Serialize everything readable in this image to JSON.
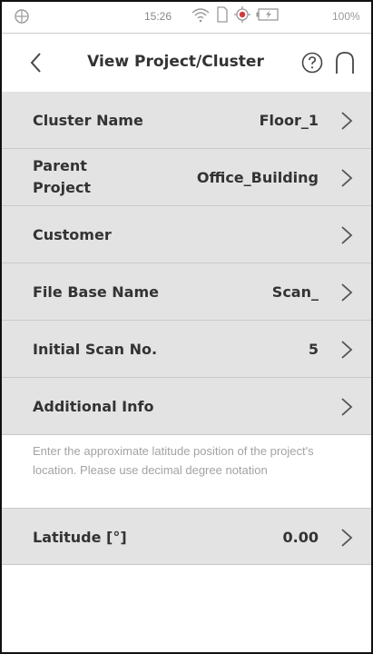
{
  "status_bar": {
    "time": "15:26",
    "battery": "100%",
    "icons": [
      "crosshair-icon",
      "wifi-icon",
      "sim-icon",
      "gps-icon",
      "battery-icon"
    ]
  },
  "header": {
    "title": "View Project/Cluster",
    "back_icon": "chevron-left-icon",
    "help_icon": "help-circle-icon",
    "home_icon": "home-arch-icon"
  },
  "rows": [
    {
      "label": "Cluster Name",
      "value": "Floor_1"
    },
    {
      "label": "Parent Project",
      "value": "Office_Building"
    },
    {
      "label": "Customer",
      "value": ""
    },
    {
      "label": "File Base Name",
      "value": "Scan_"
    },
    {
      "label": "Initial Scan No.",
      "value": "5"
    },
    {
      "label": "Additional Info",
      "value": ""
    }
  ],
  "info_text": "Enter the approximate latitude position of the project's location. Please use decimal degree notation",
  "latitude": {
    "label": "Latitude [°]",
    "value": "0.00"
  },
  "colors": {
    "row_bg": "#e3e3e3",
    "text": "#333333",
    "hint_text": "#a3a3a3"
  }
}
